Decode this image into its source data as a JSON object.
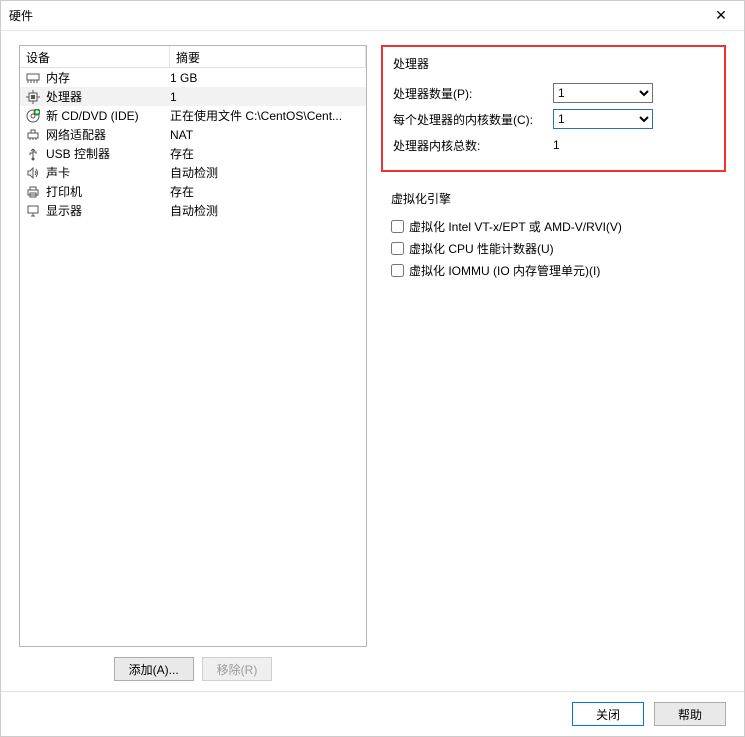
{
  "title": "硬件",
  "list": {
    "headers": {
      "device": "设备",
      "summary": "摘要"
    },
    "items": [
      {
        "icon": "memory-icon",
        "name": "内存",
        "summary": "1 GB"
      },
      {
        "icon": "cpu-icon",
        "name": "处理器",
        "summary": "1",
        "selected": true
      },
      {
        "icon": "cd-icon",
        "name": "新 CD/DVD (IDE)",
        "summary": "正在使用文件 C:\\CentOS\\Cent..."
      },
      {
        "icon": "network-icon",
        "name": "网络适配器",
        "summary": "NAT"
      },
      {
        "icon": "usb-icon",
        "name": "USB 控制器",
        "summary": "存在"
      },
      {
        "icon": "sound-icon",
        "name": "声卡",
        "summary": "自动检测"
      },
      {
        "icon": "printer-icon",
        "name": "打印机",
        "summary": "存在"
      },
      {
        "icon": "display-icon",
        "name": "显示器",
        "summary": "自动检测"
      }
    ]
  },
  "buttons": {
    "add": "添加(A)...",
    "remove": "移除(R)"
  },
  "processor": {
    "title": "处理器",
    "count_label": "处理器数量(P):",
    "count_value": "1",
    "cores_label": "每个处理器的内核数量(C):",
    "cores_value": "1",
    "total_label": "处理器内核总数:",
    "total_value": "1"
  },
  "virtualization": {
    "title": "虚拟化引擎",
    "vt_label": "虚拟化 Intel VT-x/EPT 或 AMD-V/RVI(V)",
    "counters_label": "虚拟化 CPU 性能计数器(U)",
    "iommu_label": "虚拟化 IOMMU (IO 内存管理单元)(I)"
  },
  "footer": {
    "close": "关闭",
    "help": "帮助"
  }
}
